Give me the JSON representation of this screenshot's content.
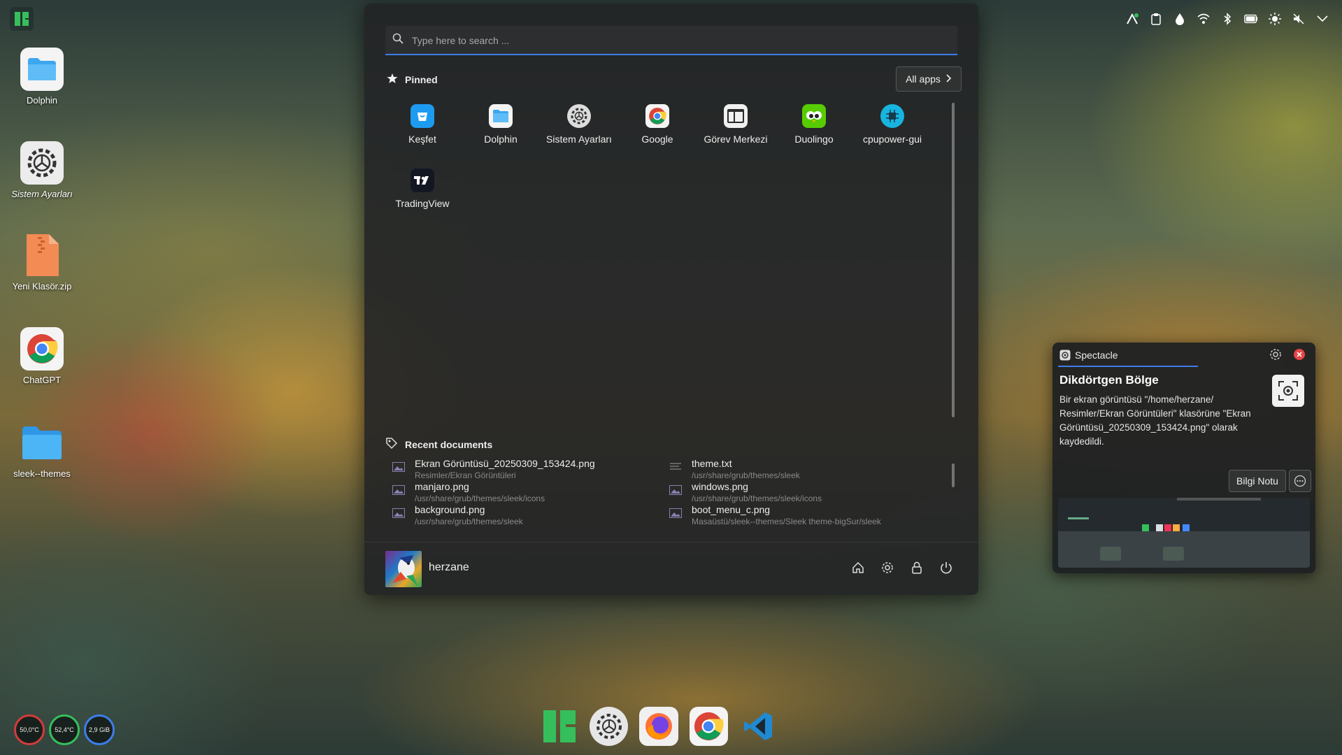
{
  "desktop": {
    "icons": [
      {
        "label": "Dolphin"
      },
      {
        "label": "Sistem Ayarları"
      },
      {
        "label": "Yeni Klasör.zip"
      },
      {
        "label": "ChatGPT"
      },
      {
        "label": "sleek--themes"
      }
    ]
  },
  "topbar": {
    "tray_icons": [
      "network-activity-icon",
      "clipboard-icon",
      "droplet-icon",
      "wifi-icon",
      "bluetooth-icon",
      "battery-icon",
      "brightness-icon",
      "mute-icon",
      "chevron-down-icon"
    ]
  },
  "launcher": {
    "search_placeholder": "Type here to search ...",
    "pinned_title": "Pinned",
    "all_apps_label": "All apps",
    "pinned_apps": [
      {
        "label": "Keşfet",
        "icon": "discover-icon"
      },
      {
        "label": "Dolphin",
        "icon": "folder-icon"
      },
      {
        "label": "Sistem Ayarları",
        "icon": "settings-icon"
      },
      {
        "label": "Google",
        "icon": "chrome-icon"
      },
      {
        "label": "Görev Merkezi",
        "icon": "task-manager-icon"
      },
      {
        "label": "Duolingo",
        "icon": "duolingo-icon"
      },
      {
        "label": "cpupower-gui",
        "icon": "cpu-icon"
      },
      {
        "label": "TradingView",
        "icon": "tradingview-icon"
      }
    ],
    "recent_title": "Recent documents",
    "recent_documents": [
      {
        "name": "Ekran Görüntüsü_20250309_153424.png",
        "path": "Resimler/Ekran Görüntüleri"
      },
      {
        "name": "theme.txt",
        "path": "/usr/share/grub/themes/sleek"
      },
      {
        "name": "manjaro.png",
        "path": "/usr/share/grub/themes/sleek/icons"
      },
      {
        "name": "windows.png",
        "path": "/usr/share/grub/themes/sleek/icons"
      },
      {
        "name": "background.png",
        "path": "/usr/share/grub/themes/sleek"
      },
      {
        "name": "boot_menu_c.png",
        "path": "Masaüstü/sleek--themes/Sleek theme-bigSur/sleek"
      }
    ],
    "user_name": "herzane"
  },
  "notification": {
    "app_name": "Spectacle",
    "title": "Dikdörtgen Bölge",
    "body": "Bir ekran görüntüsü \"/home/herzane/ Resimler/Ekran Görüntüleri\" klasörüne \"Ekran Görüntüsü_20250309_153424.png\" olarak kaydedildi.",
    "action_label": "Bilgi Notu"
  },
  "system_monitor": {
    "cpu_temp": "50,0°C",
    "gpu_temp": "52,4°C",
    "memory": "2,9 GiB"
  },
  "colors": {
    "accent": "#3d7eea",
    "panel_bg": "#222426",
    "close_red": "#e64545"
  }
}
